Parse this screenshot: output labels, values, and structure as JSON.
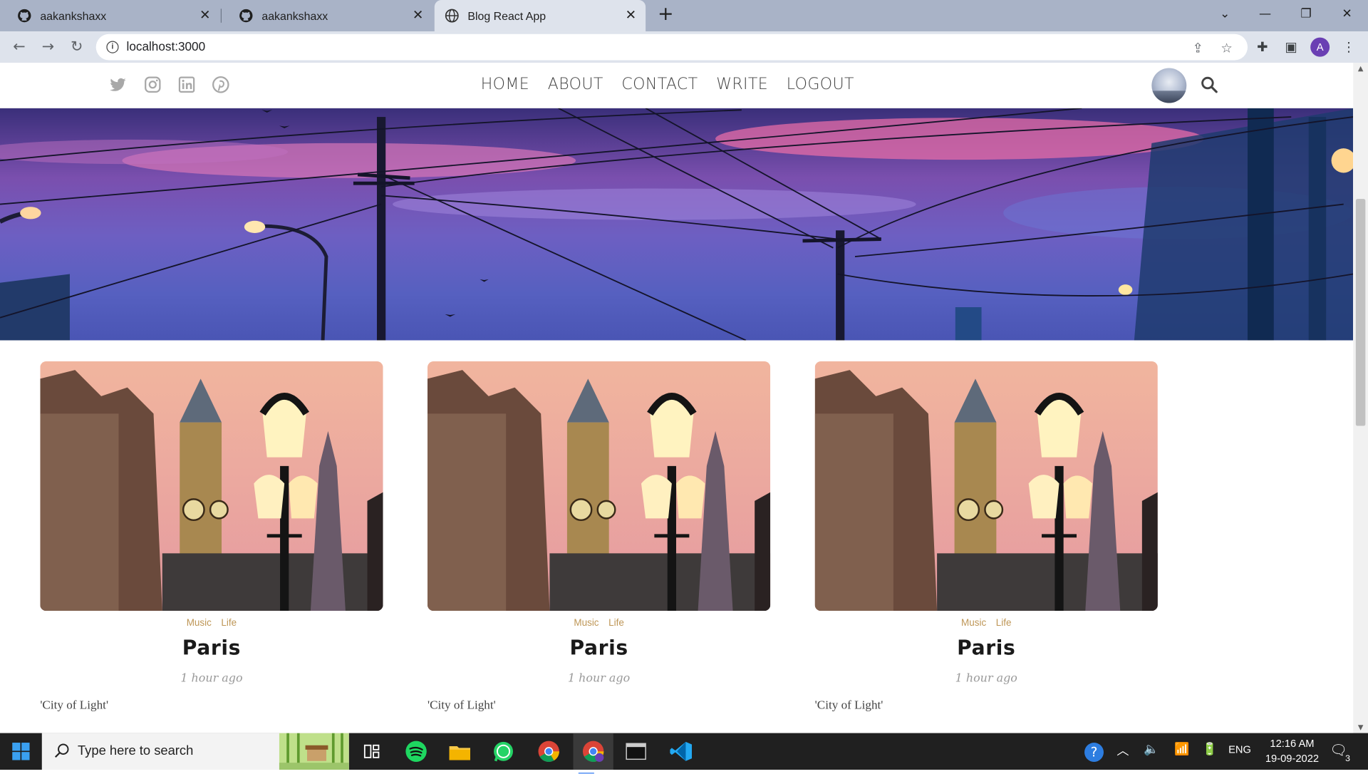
{
  "browser": {
    "tabs": [
      {
        "title": "aakankshaxx",
        "icon": "github-icon"
      },
      {
        "title": "aakankshaxx",
        "icon": "github-icon"
      },
      {
        "title": "Blog React App",
        "icon": "globe-icon",
        "active": true
      }
    ],
    "url": "localhost:3000",
    "profile_initial": "A",
    "new_tab_symbol": "+"
  },
  "site": {
    "social_icons": [
      "twitter-icon",
      "instagram-icon",
      "linkedin-icon",
      "pinterest-icon"
    ],
    "menu": [
      "HOME",
      "ABOUT",
      "CONTACT",
      "WRITE",
      "LOGOUT"
    ]
  },
  "posts": [
    {
      "categories": [
        "Music",
        "Life"
      ],
      "title": "Paris",
      "date": "1 hour ago",
      "description": "'City of Light'"
    },
    {
      "categories": [
        "Music",
        "Life"
      ],
      "title": "Paris",
      "date": "1 hour ago",
      "description": "'City of Light'"
    },
    {
      "categories": [
        "Music",
        "Life"
      ],
      "title": "Paris",
      "date": "1 hour ago",
      "description": "'City of Light'"
    }
  ],
  "taskbar": {
    "search_placeholder": "Type here to search",
    "language": "ENG",
    "time": "12:16 AM",
    "date": "19-09-2022",
    "notification_count": "3",
    "apps": [
      "task-view-icon",
      "spotify-icon",
      "file-explorer-icon",
      "whatsapp-icon",
      "chrome-icon",
      "chrome-profile-icon",
      "terminal-icon",
      "vscode-icon"
    ]
  },
  "colors": {
    "category": "#be9656",
    "tabstrip": "#a9b3c7",
    "toolbar": "#dee3ec",
    "taskbar": "#202020"
  }
}
